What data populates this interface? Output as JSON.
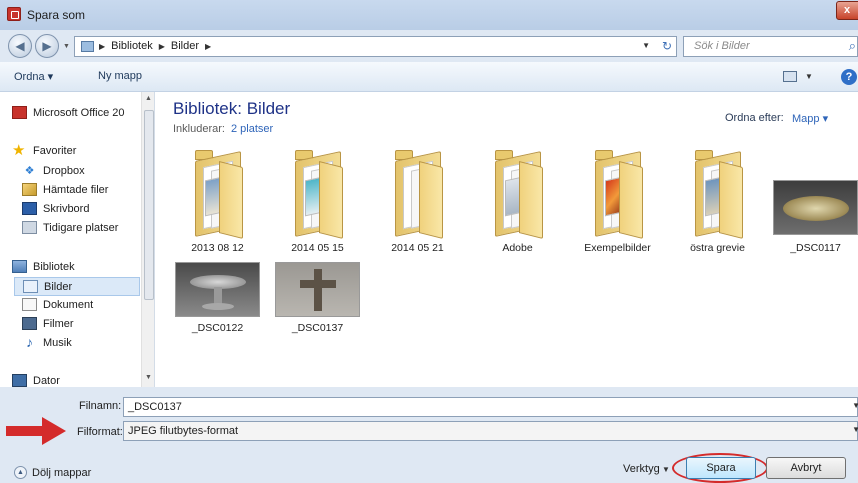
{
  "window": {
    "title": "Spara som",
    "close_glyph": "x"
  },
  "address": {
    "crumbs": [
      "Bibliotek",
      "Bilder"
    ],
    "search_placeholder": "Sök i Bilder"
  },
  "toolbar": {
    "organize": "Ordna ▾",
    "new_folder": "Ny mapp"
  },
  "sidebar": {
    "items": [
      {
        "label": "Microsoft Office 20",
        "icon": "office-icon"
      },
      {
        "label": "Favoriter",
        "icon": "star-icon"
      },
      {
        "label": "Dropbox",
        "icon": "dropbox-icon"
      },
      {
        "label": "Hämtade filer",
        "icon": "downloads-icon"
      },
      {
        "label": "Skrivbord",
        "icon": "desktop-icon"
      },
      {
        "label": "Tidigare platser",
        "icon": "recent-places-icon"
      },
      {
        "label": "Bibliotek",
        "icon": "library-icon"
      },
      {
        "label": "Bilder",
        "icon": "pictures-icon"
      },
      {
        "label": "Dokument",
        "icon": "documents-icon"
      },
      {
        "label": "Filmer",
        "icon": "videos-icon"
      },
      {
        "label": "Musik",
        "icon": "music-icon"
      },
      {
        "label": "Dator",
        "icon": "computer-icon"
      }
    ]
  },
  "main": {
    "library_title": "Bibliotek: Bilder",
    "includes_label": "Inkluderar:",
    "includes_link": "2 platser",
    "arrange_label": "Ordna efter:",
    "arrange_value": "Mapp ▾",
    "items": [
      {
        "label": "2013 08 12",
        "type": "folder"
      },
      {
        "label": "2014 05 15",
        "type": "folder"
      },
      {
        "label": "2014 05 21",
        "type": "folder"
      },
      {
        "label": "Adobe",
        "type": "folder"
      },
      {
        "label": "Exempelbilder",
        "type": "folder"
      },
      {
        "label": "östra grevie",
        "type": "folder"
      },
      {
        "label": "_DSC0117",
        "type": "image"
      },
      {
        "label": "_DSC0122",
        "type": "image"
      },
      {
        "label": "_DSC0137",
        "type": "image"
      }
    ]
  },
  "form": {
    "filename_label": "Filnamn:",
    "filename_value": "_DSC0137",
    "format_label": "Filformat:",
    "format_value": "JPEG filutbytes-format"
  },
  "footer": {
    "hide_folders": "Dölj mappar",
    "tools": "Verktyg",
    "save": "Spara",
    "cancel": "Avbryt"
  },
  "colors": {
    "annotation_red": "#d42b2b",
    "link_blue": "#2f65b9",
    "title_blue": "#1e3287"
  }
}
